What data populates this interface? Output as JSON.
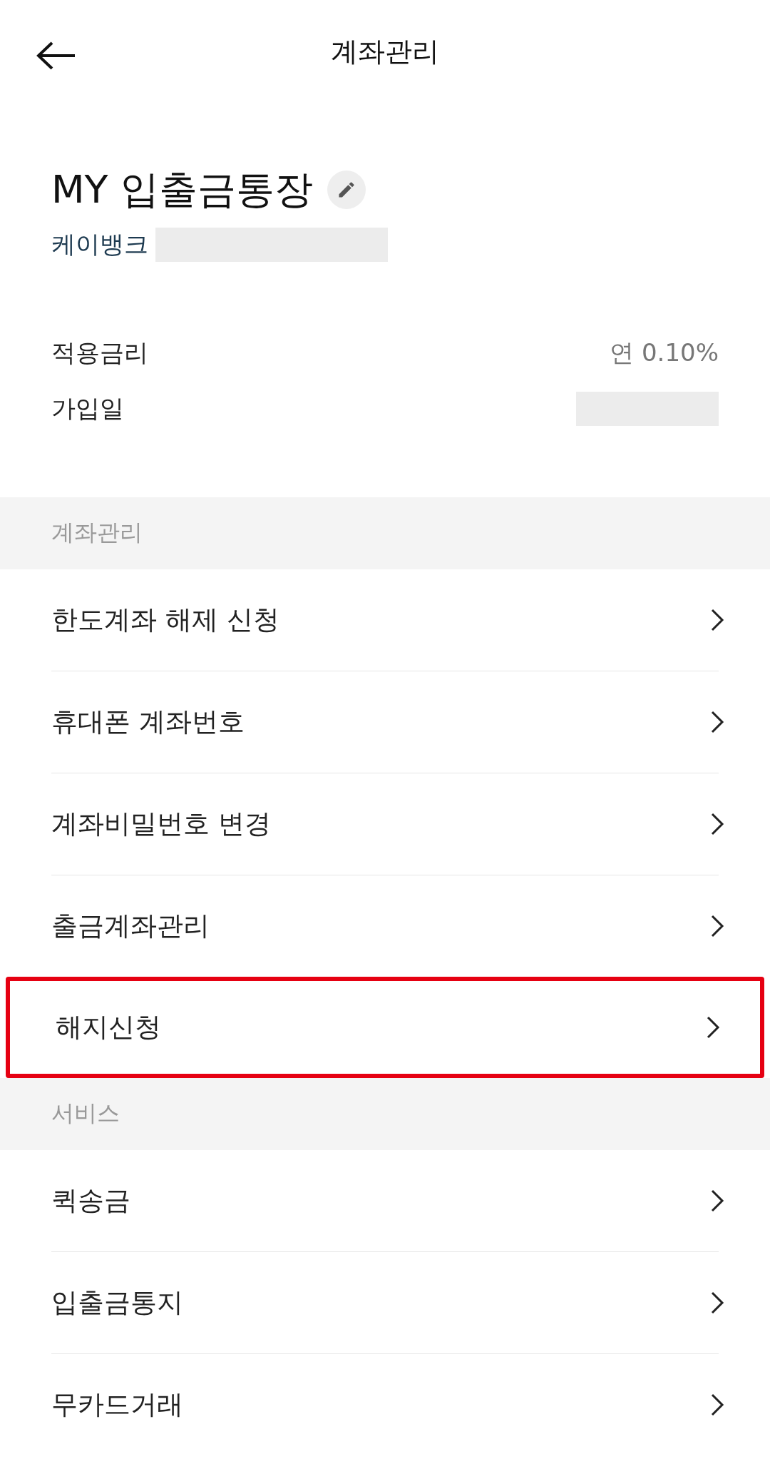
{
  "header": {
    "title": "계좌관리"
  },
  "account": {
    "name": "MY 입출금통장",
    "bank": "케이뱅크"
  },
  "details": [
    {
      "label": "적용금리",
      "value": "연 0.10%",
      "redacted": false
    },
    {
      "label": "가입일",
      "redacted": true
    }
  ],
  "sections": [
    {
      "title": "계좌관리",
      "items": [
        {
          "label": "한도계좌 해제 신청",
          "highlighted": false
        },
        {
          "label": "휴대폰 계좌번호",
          "highlighted": false
        },
        {
          "label": "계좌비밀번호 변경",
          "highlighted": false
        },
        {
          "label": "출금계좌관리",
          "highlighted": false
        },
        {
          "label": "해지신청",
          "highlighted": true
        }
      ]
    },
    {
      "title": "서비스",
      "items": [
        {
          "label": "퀵송금",
          "highlighted": false
        },
        {
          "label": "입출금통지",
          "highlighted": false
        },
        {
          "label": "무카드거래",
          "highlighted": false
        }
      ]
    }
  ]
}
